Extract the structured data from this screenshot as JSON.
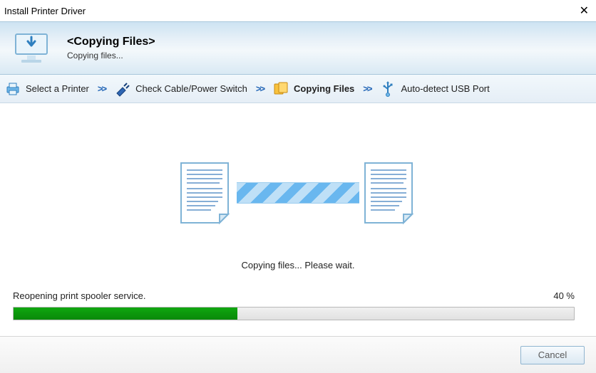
{
  "window": {
    "title": "Install Printer Driver"
  },
  "header": {
    "title": "<Copying Files>",
    "subtitle": "Copying files..."
  },
  "steps": {
    "s1": "Select a Printer",
    "s2": "Check Cable/Power Switch",
    "s3": "Copying Files",
    "s4": "Auto-detect USB Port"
  },
  "main": {
    "center_message": "Copying files... Please wait.",
    "task_label": "Reopening print spooler service.",
    "percent_label": "40 %",
    "percent_value": 40
  },
  "footer": {
    "cancel": "Cancel"
  }
}
